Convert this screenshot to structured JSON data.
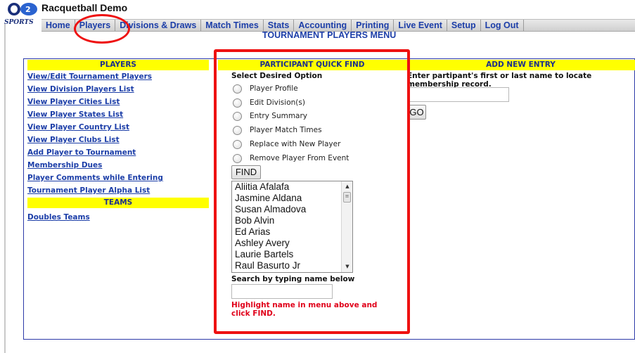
{
  "app": {
    "title": "Racquetball Demo",
    "logo_text": "SPORTS"
  },
  "nav": {
    "items": [
      "Home",
      "Players",
      "Divisions & Draws",
      "Match Times",
      "Stats",
      "Accounting",
      "Printing",
      "Live Event",
      "Setup",
      "Log Out"
    ]
  },
  "page": {
    "title": "TOURNAMENT PLAYERS MENU"
  },
  "players": {
    "heading": "PLAYERS",
    "links": [
      "View/Edit Tournament Players",
      "View Division Players List",
      "View Player Cities List",
      "View Player States List",
      "View Player Country List",
      "View Player Clubs List",
      "Add Player to Tournament",
      "Membership Dues",
      "Player Comments while Entering",
      "Tournament Player Alpha List"
    ]
  },
  "teams": {
    "heading": "TEAMS",
    "links": [
      "Doubles Teams"
    ]
  },
  "quick_find": {
    "heading": "PARTICIPANT QUICK FIND",
    "select_label": "Select Desired Option",
    "options": [
      "Player Profile",
      "Edit Division(s)",
      "Entry Summary",
      "Player Match Times",
      "Replace with New Player",
      "Remove Player From Event"
    ],
    "find_button": "FIND",
    "player_list": [
      "Aliitia Afalafa",
      "Jasmine Aldana",
      "Susan Almadova",
      "Bob Alvin",
      "Ed Arias",
      "Ashley Avery",
      "Laurie Bartels",
      "Raul Basurto Jr"
    ],
    "search_label": "Search by typing name below",
    "search_value": "",
    "hint": "Highlight name in menu above and click FIND."
  },
  "add_new": {
    "heading": "ADD NEW ENTRY",
    "instructions": "Enter partipant's first or last name to locate membership record.",
    "input_value": "",
    "go_button": "GO"
  },
  "colors": {
    "link": "#1c3ea8",
    "section_heading_bg": "#ffff00",
    "annotation": "#ee1111",
    "hint": "#e0001a"
  }
}
